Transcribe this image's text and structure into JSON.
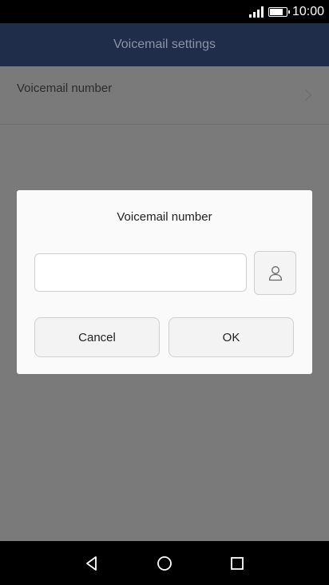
{
  "status_bar": {
    "time": "10:00",
    "battery_level": 0.85,
    "icons": [
      "signal-icon",
      "battery-icon"
    ]
  },
  "header": {
    "title": "Voicemail settings"
  },
  "list": {
    "items": [
      {
        "label": "Voicemail number",
        "icon": "chevron-right-icon"
      }
    ]
  },
  "dialog": {
    "title": "Voicemail number",
    "input_value": "",
    "contact_icon": "contact-person-icon",
    "cancel_label": "Cancel",
    "ok_label": "OK"
  },
  "nav_bar": {
    "icons": [
      "back-icon",
      "home-icon",
      "recents-icon"
    ]
  },
  "colors": {
    "header_bg": "#1f2c4a",
    "scrim": "#7a7a7a",
    "dialog_bg": "#fafafa"
  }
}
